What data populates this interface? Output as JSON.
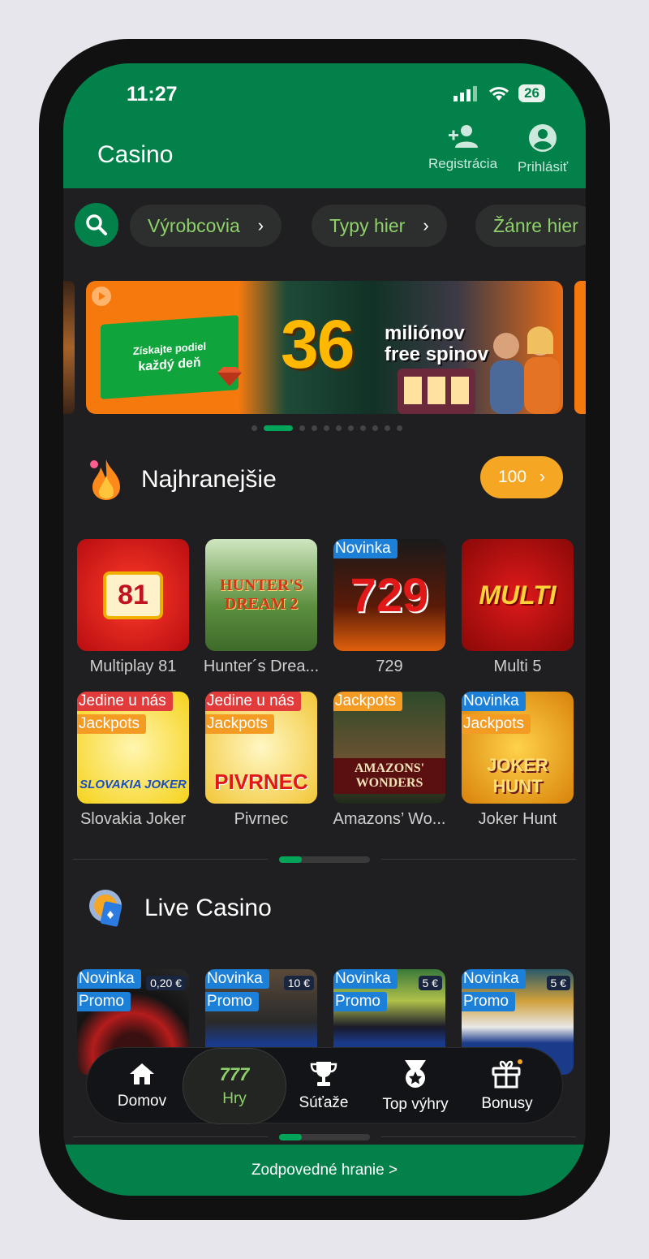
{
  "status": {
    "time": "11:27",
    "battery": "26"
  },
  "header": {
    "title": "Casino",
    "register_label": "Registrácia",
    "login_label": "Prihlásiť"
  },
  "filters": {
    "items": [
      {
        "label": "Výrobcovia"
      },
      {
        "label": "Typy hier"
      },
      {
        "label": "Žánre hier"
      }
    ]
  },
  "banner": {
    "line1": "Získajte podiel",
    "line2": "každý deň",
    "big_number": "36",
    "text1": "miliónov",
    "text2": "free spinov",
    "active_slide": 2,
    "slides": 11
  },
  "most_played": {
    "title": "Najhranejšie",
    "count": "100",
    "games": [
      {
        "name": "Multiplay 81",
        "art": "81",
        "tags": []
      },
      {
        "name": "Hunter´s Drea...",
        "art": "HUNTER'S DREAM 2",
        "tags": []
      },
      {
        "name": "729",
        "art": "729",
        "tags": [
          {
            "text": "Novinka",
            "color": "blue"
          }
        ]
      },
      {
        "name": "Multi 5",
        "art": "MULTI",
        "tags": []
      },
      {
        "name": "Slovakia Joker",
        "art": "SLOVAKIA JOKER",
        "tags": [
          {
            "text": "Jedine u nás",
            "color": "red"
          },
          {
            "text": "Jackpots",
            "color": "orange"
          }
        ]
      },
      {
        "name": "Pivrnec",
        "art": "PIVRNEC",
        "tags": [
          {
            "text": "Jedine u nás",
            "color": "red"
          },
          {
            "text": "Jackpots",
            "color": "orange"
          }
        ]
      },
      {
        "name": "Amazons’ Wo...",
        "art": "AMAZONS' WONDERS",
        "tags": [
          {
            "text": "Jackpots",
            "color": "orange"
          }
        ]
      },
      {
        "name": "Joker Hunt",
        "art": "JOKER HUNT",
        "tags": [
          {
            "text": "Novinka",
            "color": "blue"
          },
          {
            "text": "Jackpots",
            "color": "orange"
          }
        ]
      }
    ]
  },
  "live_casino": {
    "title": "Live Casino",
    "games": [
      {
        "bet": "0,20 €",
        "tags": [
          {
            "text": "Novinka",
            "color": "blue"
          },
          {
            "text": "Promo",
            "color": "blue"
          }
        ]
      },
      {
        "bet": "10 €",
        "tags": [
          {
            "text": "Novinka",
            "color": "blue"
          },
          {
            "text": "Promo",
            "color": "blue"
          }
        ]
      },
      {
        "bet": "5 €",
        "tags": [
          {
            "text": "Novinka",
            "color": "blue"
          },
          {
            "text": "Promo",
            "color": "blue"
          }
        ]
      },
      {
        "bet": "5 €",
        "tags": [
          {
            "text": "Novinka",
            "color": "blue"
          },
          {
            "text": "Promo",
            "color": "blue"
          }
        ]
      }
    ]
  },
  "tabbar": {
    "home": "Domov",
    "games_icon": "777",
    "games": "Hry",
    "competitions": "Súťaže",
    "top_wins": "Top výhry",
    "bonuses": "Bonusy",
    "active": "Hry"
  },
  "footer": {
    "label": "Zodpovedné hranie >"
  },
  "colors": {
    "brand_green": "#02814a",
    "accent_green": "#8ed16a",
    "orange": "#f5a623",
    "tag_blue": "#1c7fd8",
    "tag_red": "#e23b3b"
  }
}
